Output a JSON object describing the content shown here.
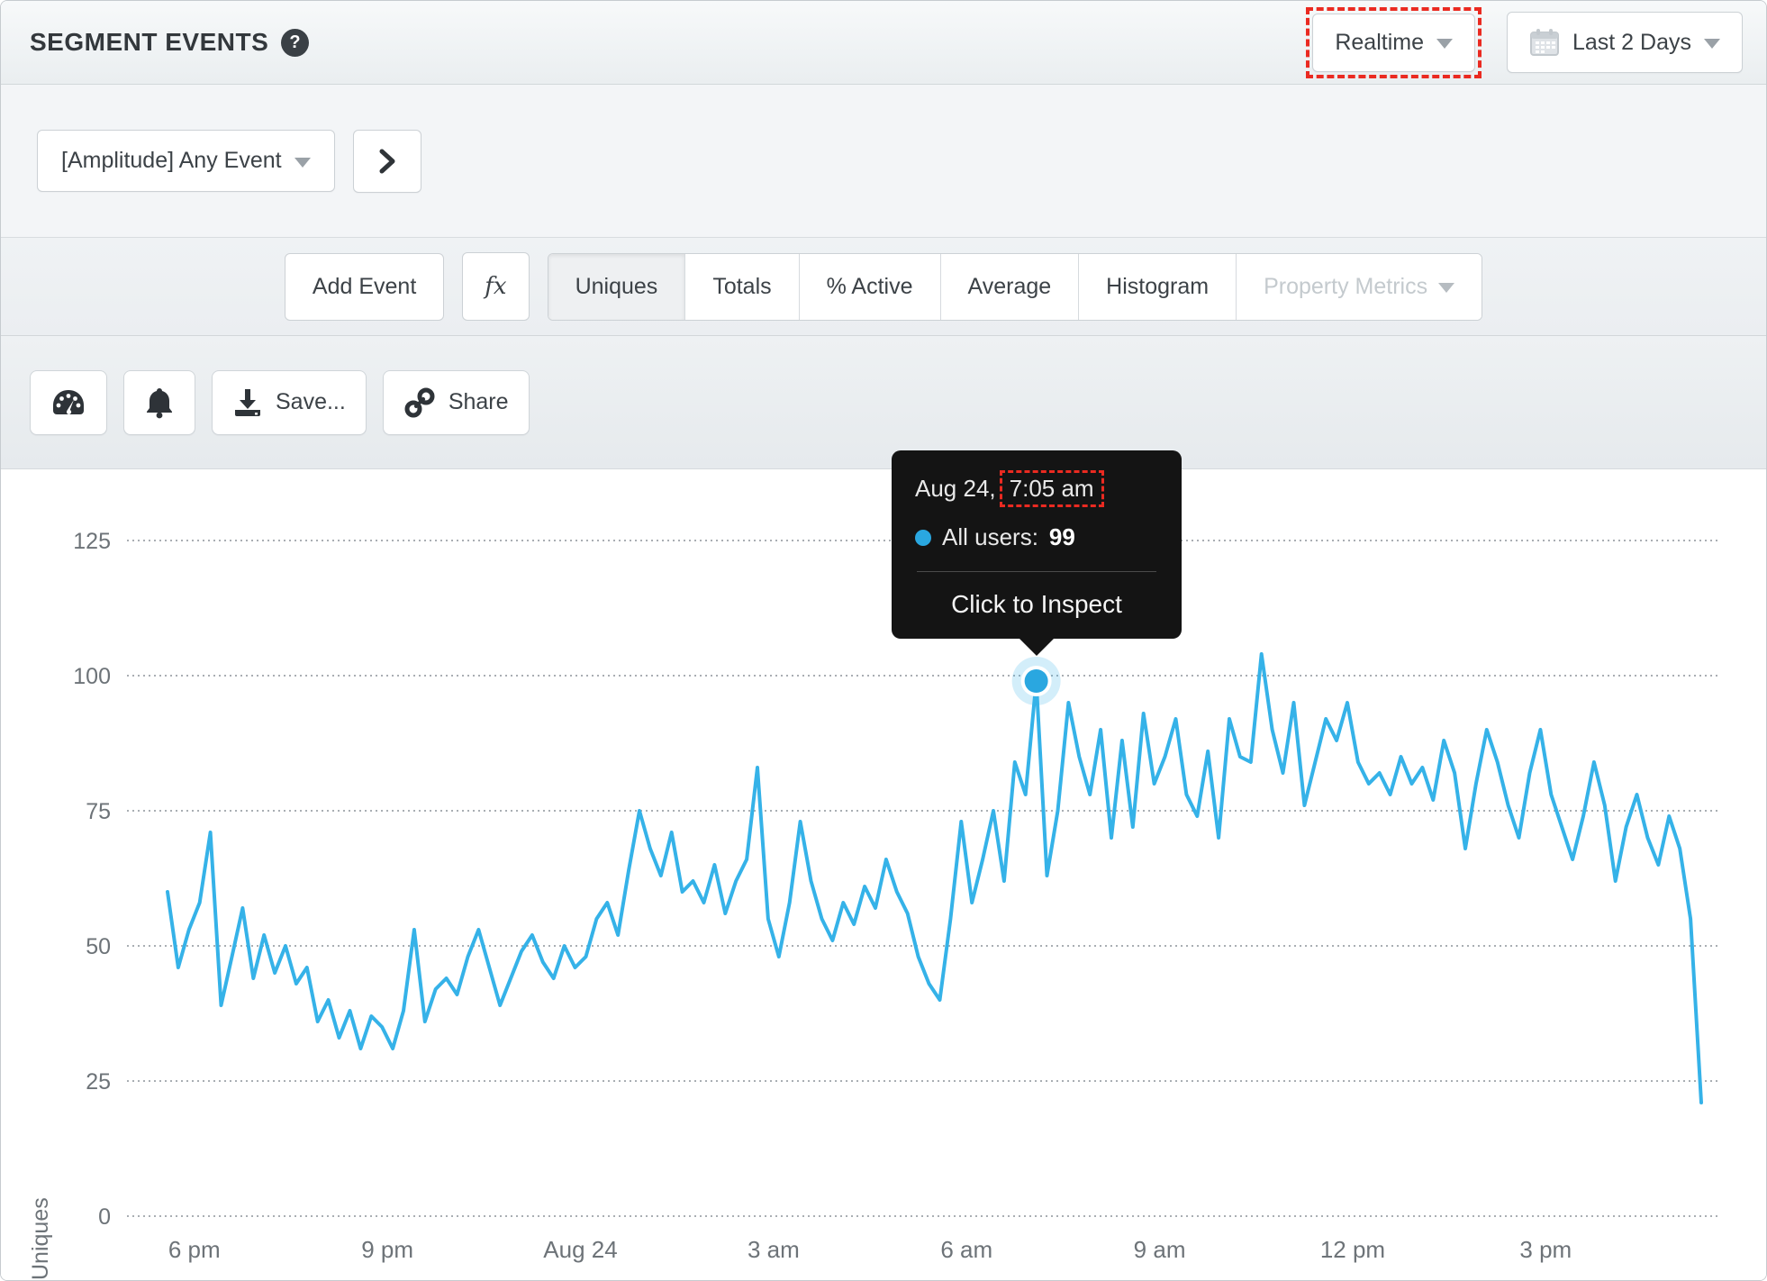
{
  "header": {
    "title": "SEGMENT EVENTS",
    "help": "?",
    "realtime_label": "Realtime",
    "date_range_label": "Last 2 Days"
  },
  "event_row": {
    "event_selector_label": "[Amplitude] Any Event"
  },
  "controls": {
    "add_event_label": "Add Event",
    "formula_label": "fx",
    "metric_tabs": [
      {
        "label": "Uniques"
      },
      {
        "label": "Totals"
      },
      {
        "label": "% Active"
      },
      {
        "label": "Average"
      },
      {
        "label": "Histogram"
      },
      {
        "label": "Property Metrics"
      }
    ]
  },
  "toolbar": {
    "save_label": "Save...",
    "share_label": "Share"
  },
  "tooltip": {
    "date_prefix": "Aug 24,",
    "time": "7:05 am",
    "series_label": "All users:",
    "value": "99",
    "action": "Click to Inspect"
  },
  "colors": {
    "line_blue": "#35b2e8",
    "dot_blue": "#2aa7e0",
    "halo_blue": "rgba(53,178,232,0.22)",
    "highlight_red": "#ea2a21",
    "tooltip_bg": "#141414",
    "grid_gray": "#a9aeb3",
    "tick_text": "#6d7378"
  },
  "chart_data": {
    "type": "line",
    "title": "",
    "xlabel": "",
    "ylabel": "Uniques",
    "ylim": [
      0,
      130
    ],
    "y_ticks": [
      0,
      25,
      50,
      75,
      100,
      125
    ],
    "grid": "dotted-horizontal",
    "x_ticks": [
      {
        "label": "6 pm",
        "index": 2.5
      },
      {
        "label": "9 pm",
        "index": 20.5
      },
      {
        "label": "Aug 24",
        "index": 38.5
      },
      {
        "label": "3 am",
        "index": 56.5
      },
      {
        "label": "6 am",
        "index": 74.5
      },
      {
        "label": "9 am",
        "index": 92.5
      },
      {
        "label": "12 pm",
        "index": 110.5
      },
      {
        "label": "3 pm",
        "index": 128.5
      }
    ],
    "series": [
      {
        "name": "All users",
        "color": "#35b2e8",
        "values": [
          60,
          46,
          53,
          58,
          71,
          39,
          48,
          57,
          44,
          52,
          45,
          50,
          43,
          46,
          36,
          40,
          33,
          38,
          31,
          37,
          35,
          31,
          38,
          53,
          36,
          42,
          44,
          41,
          48,
          53,
          46,
          39,
          44,
          49,
          52,
          47,
          44,
          50,
          46,
          48,
          55,
          58,
          52,
          64,
          75,
          68,
          63,
          71,
          60,
          62,
          58,
          65,
          56,
          62,
          66,
          83,
          55,
          48,
          58,
          73,
          62,
          55,
          51,
          58,
          54,
          61,
          57,
          66,
          60,
          56,
          48,
          43,
          40,
          55,
          73,
          58,
          66,
          75,
          62,
          84,
          78,
          99,
          63,
          75,
          95,
          85,
          78,
          90,
          70,
          88,
          72,
          93,
          80,
          85,
          92,
          78,
          74,
          86,
          70,
          92,
          85,
          84,
          104,
          90,
          82,
          95,
          76,
          84,
          92,
          88,
          95,
          84,
          80,
          82,
          78,
          85,
          80,
          83,
          77,
          88,
          82,
          68,
          80,
          90,
          84,
          76,
          70,
          82,
          90,
          78,
          72,
          66,
          74,
          84,
          76,
          62,
          72,
          78,
          70,
          65,
          74,
          68,
          55,
          21
        ]
      }
    ],
    "highlight": {
      "series": "All users",
      "index": 81,
      "value": 99,
      "time_label": "Aug 24, 7:05 am"
    }
  }
}
